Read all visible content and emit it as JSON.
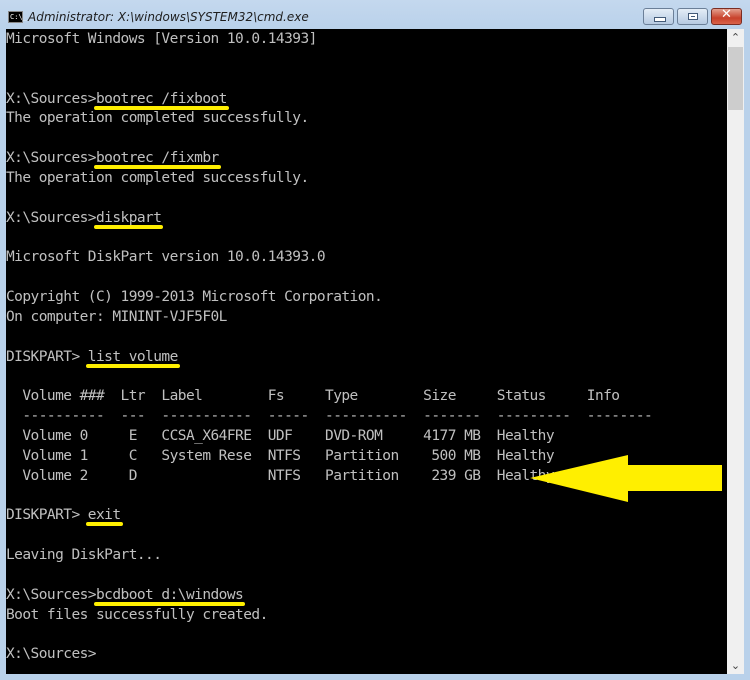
{
  "window": {
    "title": "Administrator: X:\\windows\\SYSTEM32\\cmd.exe",
    "icon": "cmd-icon",
    "icon_text": "C:\\_",
    "controls": {
      "minimize": "minimize-icon",
      "maximize": "maximize-icon",
      "close": "close-icon",
      "close_glyph": "✕"
    }
  },
  "console": {
    "lines": [
      "Microsoft Windows [Version 10.0.14393]",
      "",
      "",
      "X:\\Sources>bootrec /fixboot",
      "The operation completed successfully.",
      "",
      "X:\\Sources>bootrec /fixmbr",
      "The operation completed successfully.",
      "",
      "X:\\Sources>diskpart",
      "",
      "Microsoft DiskPart version 10.0.14393.0",
      "",
      "Copyright (C) 1999-2013 Microsoft Corporation.",
      "On computer: MININT-VJF5F0L",
      "",
      "DISKPART> list volume",
      "",
      "  Volume ###  Ltr  Label        Fs     Type        Size     Status     Info",
      "  ----------  ---  -----------  -----  ----------  -------  ---------  --------",
      "  Volume 0     E   CCSA_X64FRE  UDF    DVD-ROM     4177 MB  Healthy",
      "  Volume 1     C   System Rese  NTFS   Partition    500 MB  Healthy",
      "  Volume 2     D                NTFS   Partition    239 GB  Healthy",
      "",
      "DISKPART> exit",
      "",
      "Leaving DiskPart...",
      "",
      "X:\\Sources>bcdboot d:\\windows",
      "Boot files successfully created.",
      "",
      "X:\\Sources>"
    ],
    "volumes_table": {
      "columns": [
        "Volume ###",
        "Ltr",
        "Label",
        "Fs",
        "Type",
        "Size",
        "Status",
        "Info"
      ],
      "rows": [
        [
          "Volume 0",
          "E",
          "CCSA_X64FRE",
          "UDF",
          "DVD-ROM",
          "4177 MB",
          "Healthy",
          ""
        ],
        [
          "Volume 1",
          "C",
          "System Rese",
          "NTFS",
          "Partition",
          "500 MB",
          "Healthy",
          ""
        ],
        [
          "Volume 2",
          "D",
          "",
          "NTFS",
          "Partition",
          "239 GB",
          "Healthy",
          ""
        ]
      ]
    },
    "highlighted_commands": [
      "bootrec /fixboot",
      "bootrec /fixmbr",
      "diskpart",
      "list volume",
      "exit",
      "bcdboot d:\\windows"
    ],
    "annotation": {
      "type": "arrow-left",
      "points_to": "Volume 2 (239 GB)",
      "color": "#ffef00"
    }
  },
  "colors": {
    "console_bg": "#000000",
    "console_text": "#c0c0c0",
    "highlight": "#ffef00",
    "frame": "#b9d1ea"
  },
  "scrollbar": {
    "up": "chevron-up-icon",
    "down": "chevron-down-icon",
    "up_glyph": "⌃",
    "down_glyph": "⌄"
  }
}
